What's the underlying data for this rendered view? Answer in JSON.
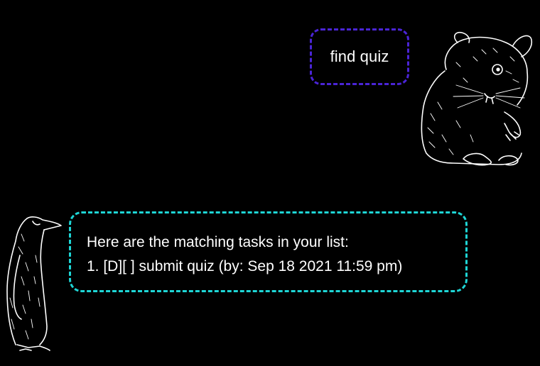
{
  "conversation": {
    "user_message": "find quiz",
    "bot_response": {
      "header": "Here are the matching tasks in your list:",
      "lines": [
        "1. [D][ ] submit quiz (by: Sep 18 2021 11:59 pm)"
      ]
    }
  },
  "avatars": {
    "user": "hamster-icon",
    "bot": "penguin-icon"
  },
  "colors": {
    "background": "#000000",
    "user_bubble_border": "#4a24d6",
    "bot_bubble_border": "#1ed6d6",
    "text": "#ffffff"
  }
}
